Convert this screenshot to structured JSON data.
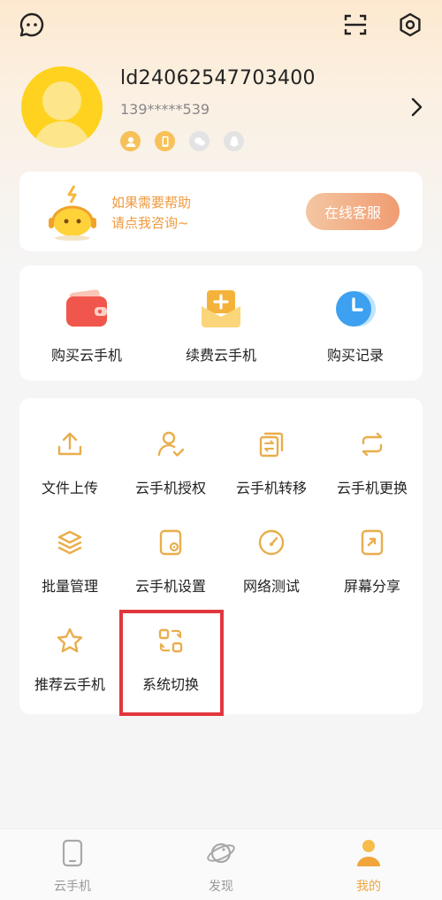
{
  "profile": {
    "username": "ld24062547703400",
    "phone": "139*****539"
  },
  "help": {
    "line1": "如果需要帮助",
    "line2": "请点我咨询~",
    "button": "在线客服"
  },
  "purchase": {
    "items": [
      {
        "label": "购买云手机"
      },
      {
        "label": "续费云手机"
      },
      {
        "label": "购买记录"
      }
    ]
  },
  "tools": {
    "items": [
      {
        "label": "文件上传"
      },
      {
        "label": "云手机授权"
      },
      {
        "label": "云手机转移"
      },
      {
        "label": "云手机更换"
      },
      {
        "label": "批量管理"
      },
      {
        "label": "云手机设置"
      },
      {
        "label": "网络测试"
      },
      {
        "label": "屏幕分享"
      },
      {
        "label": "推荐云手机"
      },
      {
        "label": "系统切换"
      }
    ]
  },
  "nav": {
    "items": [
      {
        "label": "云手机"
      },
      {
        "label": "发现"
      },
      {
        "label": "我的"
      }
    ]
  },
  "colors": {
    "accent": "#f1a53b",
    "highlight": "#e0373d",
    "avatar": "#ffd21f"
  }
}
